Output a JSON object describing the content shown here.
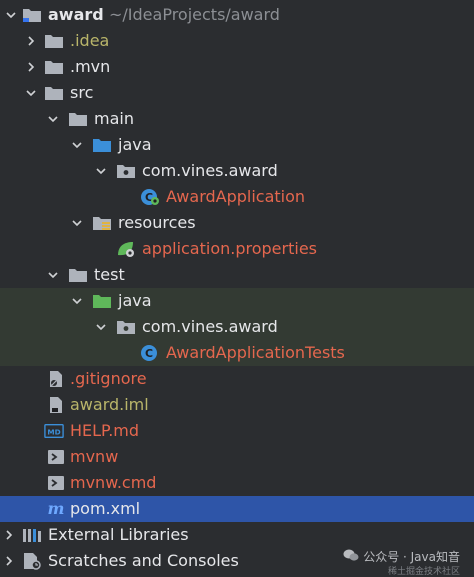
{
  "tree": {
    "root_name": "award",
    "root_path": "~/IdeaProjects/award",
    "items": {
      "idea": ".idea",
      "mvn": ".mvn",
      "src": "src",
      "main": "main",
      "main_java": "java",
      "main_package": "com.vines.award",
      "main_class": "AwardApplication",
      "resources": "resources",
      "app_properties": "application.properties",
      "test": "test",
      "test_java": "java",
      "test_package": "com.vines.award",
      "test_class": "AwardApplicationTests",
      "gitignore": ".gitignore",
      "award_iml": "award.iml",
      "help_md": "HELP.md",
      "mvnw": "mvnw",
      "mvnw_cmd": "mvnw.cmd",
      "pom": "pom.xml",
      "external_libraries": "External Libraries",
      "scratches": "Scratches and Consoles"
    }
  },
  "watermark": {
    "text": "公众号 · Java知音",
    "sub": "稀土掘金技术社区"
  },
  "colors": {
    "background": "#2b2d30",
    "selection": "#2e55a8",
    "test_highlight": "#333a33",
    "modified_olive": "#b9b56a",
    "untracked_red": "#e5674e"
  }
}
